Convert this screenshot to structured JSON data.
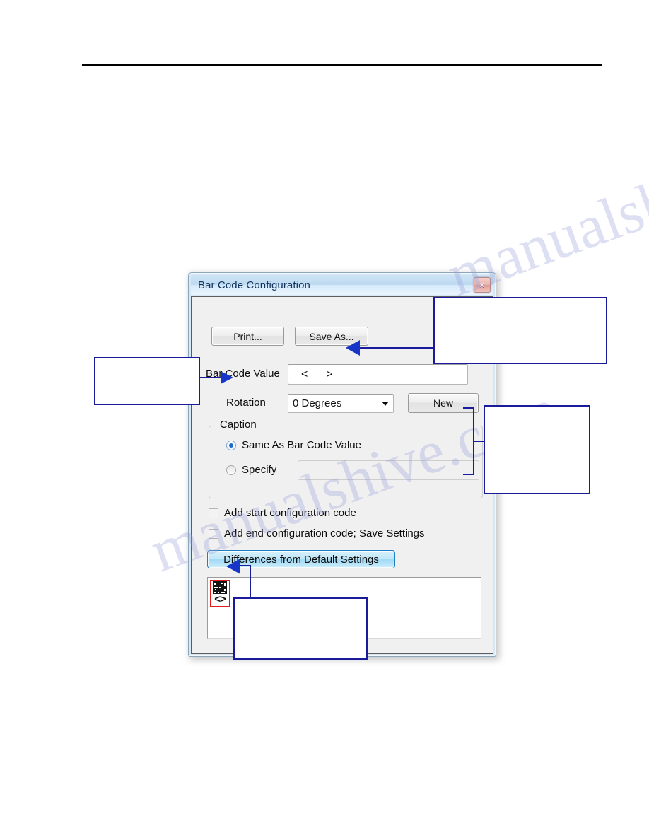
{
  "page": {
    "rule_present": true,
    "watermark_text": "manualshive.com",
    "watermark_color": "#9aa0d8"
  },
  "dialog": {
    "title": "Bar Code Configuration",
    "close_button_label": "x",
    "close_icon_name": "close-icon",
    "accent_border": "#8aa7bd",
    "titlebar_color": "#cfe4f6",
    "toolbar": {
      "print_label": "Print...",
      "save_as_label": "Save As..."
    },
    "barcode_value": {
      "label": "Bar Code Value",
      "value_left": "<",
      "value_right": ">",
      "placeholder": ""
    },
    "rotation": {
      "label": "Rotation",
      "selected": "0 Degrees",
      "options": [
        "0 Degrees"
      ]
    },
    "new_button_label": "New",
    "caption_group": {
      "legend": "Caption",
      "radio_same_label": "Same As Bar Code Value",
      "radio_same_checked": true,
      "radio_specify_label": "Specify",
      "radio_specify_checked": false,
      "specify_value": "",
      "specify_placeholder": ""
    },
    "checkboxes": [
      {
        "label": "Add start configuration code",
        "checked": false
      },
      {
        "label": "Add end configuration code; Save Settings",
        "checked": false
      }
    ],
    "differences_button": {
      "label": "Differences from Default Settings",
      "accent_color": "#1f7fc4"
    },
    "preview": {
      "item_caption": "<>",
      "item_icon_name": "barcode-glyph-icon",
      "selection_color": "#e01b1b"
    }
  },
  "annotations": {
    "border_color": "#1a1a9c",
    "arrow_color": "#1736c8",
    "callouts": [
      {
        "name": "callout-barcode-value",
        "text": ""
      },
      {
        "name": "callout-rotation",
        "text": ""
      },
      {
        "name": "callout-caption",
        "text": ""
      },
      {
        "name": "callout-preview-item",
        "text": ""
      }
    ]
  }
}
